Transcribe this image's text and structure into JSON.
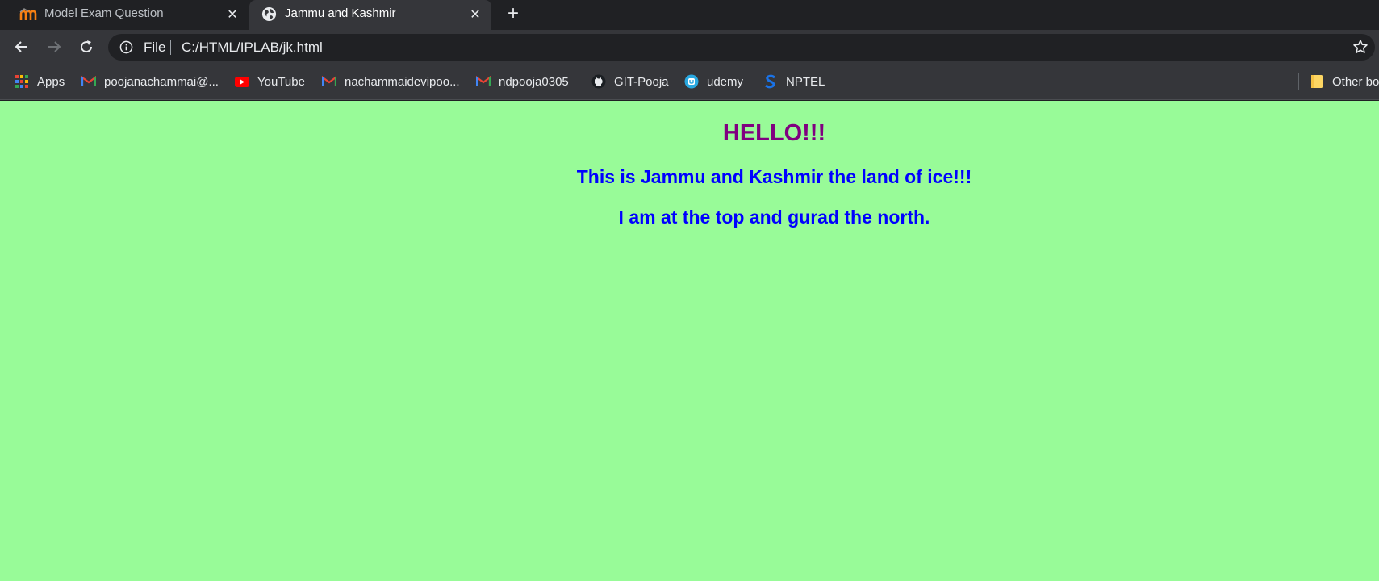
{
  "tabs": [
    {
      "title": "Model Exam Question",
      "favicon": "moodle-icon",
      "active": false
    },
    {
      "title": "Jammu and Kashmir",
      "favicon": "globe-icon",
      "active": true
    }
  ],
  "toolbar": {
    "scheme": "File",
    "url": "C:/HTML/IPLAB/jk.html"
  },
  "bookmarks": [
    {
      "label": "Apps",
      "icon": "apps-grid-icon"
    },
    {
      "label": "poojanachammai@...",
      "icon": "gmail-icon"
    },
    {
      "label": "YouTube",
      "icon": "youtube-icon"
    },
    {
      "label": "nachammaidevipoo...",
      "icon": "gmail-icon"
    },
    {
      "label": "ndpooja0305",
      "icon": "gmail-icon"
    },
    {
      "label": "GIT-Pooja",
      "icon": "github-icon"
    },
    {
      "label": "udemy",
      "icon": "udemy-icon"
    },
    {
      "label": "NPTEL",
      "icon": "nptel-icon"
    },
    {
      "label": "Other bookmarks",
      "icon": "folder-icon"
    }
  ],
  "page": {
    "heading1": "HELLO!!!",
    "heading2": "This is Jammu and Kashmir the land of ice!!!",
    "heading3": "I am at the top and gurad the north."
  },
  "colors": {
    "page_background": "#98fb98",
    "heading1": "#800080",
    "heading2": "#0000ff",
    "browser_frame": "#202124",
    "toolbar": "#35363a"
  }
}
